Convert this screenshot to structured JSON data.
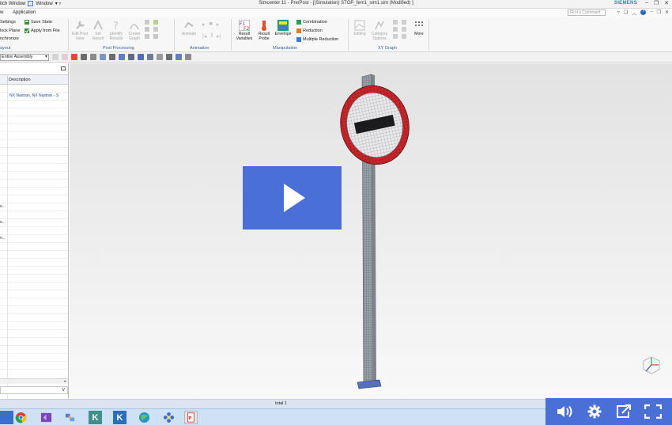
{
  "titlebar": {
    "switch_window": "itch Window",
    "window_menu": "Window",
    "title": "Simcenter 11 - Pre/Post - [(Simulation) STOP_fem1_sim1.sim (Modified) ]",
    "brand": "SIEMENS"
  },
  "menubar": {
    "items": [
      "w",
      "Application"
    ],
    "search_placeholder": "Find a Command"
  },
  "ribbon": {
    "left_items": [
      "Settings",
      "lock Plane",
      "nchronize"
    ],
    "state_items": [
      "Save State",
      "Apply from File"
    ],
    "left_group": "ayout",
    "post_processing": {
      "buttons": [
        "Edit Post View",
        "Set Result",
        "Identify Results",
        "Create Graph"
      ],
      "label": "Post Processing"
    },
    "animation": {
      "button": "Animate",
      "label": "Animation"
    },
    "manipulation": {
      "big_buttons": [
        "Result Variables",
        "Result Probe",
        "Envelope"
      ],
      "small_buttons": [
        "Combination",
        "Reduction",
        "Multiple Reduction"
      ],
      "label": "Manipulation"
    },
    "xy_graph": {
      "buttons": [
        "Editing",
        "Category Options"
      ],
      "more": "More",
      "label": "XY Graph"
    }
  },
  "cmdbar": {
    "filter": "Entire Assembly"
  },
  "navigator": {
    "column": "Description",
    "first_row": "NX Nastran, NX Nastran - S",
    "truncated_rows": [
      "e...",
      "e...",
      "n..."
    ]
  },
  "status": {
    "text": "total 1"
  },
  "taskbar": {
    "apps": [
      "windows-app",
      "chrome",
      "visual-studio",
      "network",
      "k-app-1",
      "k-app-2",
      "browser-globe",
      "flower-app",
      "pdf-app"
    ]
  },
  "video": {
    "controls": [
      "volume-icon",
      "settings-icon",
      "share-icon",
      "fullscreen-icon"
    ]
  },
  "colors": {
    "accent": "#4a6fd6",
    "sign_ring": "#c8262b",
    "mesh": "#7a7f88",
    "ribbon_label": "#3a5fa8"
  }
}
